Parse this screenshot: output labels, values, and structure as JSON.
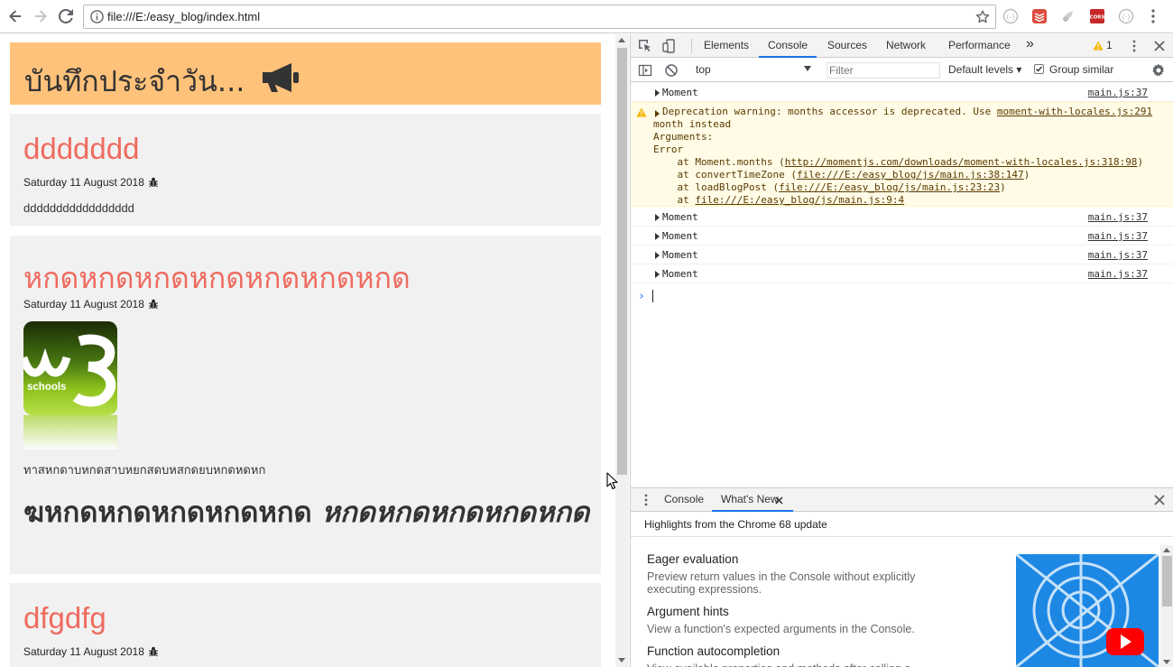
{
  "browser": {
    "url": "file:///E:/easy_blog/index.html"
  },
  "blog": {
    "header_title": "บันทึกประจำวัน...",
    "header_color": "#ffc27a",
    "title_color": "#ef6b5f",
    "posts": [
      {
        "title": "ddddddd",
        "date": "Saturday 11 August 2018",
        "body": "ddddddddddddddddd"
      },
      {
        "title": "หกดหกดหกดหกดหกดหกดหกด",
        "date": "Saturday 11 August 2018",
        "image_text": "schools",
        "body": "ทาสหกดาบหกดสาบหยกสดบหสกดยบหกดหดหก",
        "heading_bold": "ฆหกดหกดหกดหกดหกด",
        "heading_italic": "หกดหกดหกดหกดหกด"
      },
      {
        "title": "dfgdfg",
        "date": "Saturday 11 August 2018"
      }
    ]
  },
  "devtools": {
    "tabs": [
      "Elements",
      "Console",
      "Sources",
      "Network",
      "Performance"
    ],
    "active_tab": "Console",
    "more_tabs": "»",
    "warning_count": "1",
    "context": "top",
    "filter_placeholder": "Filter",
    "levels": "Default levels ▾",
    "group_similar": "Group similar",
    "messages": [
      {
        "text": "Moment",
        "source": "main.js:37"
      },
      {
        "level": "warning",
        "line1": "Deprecation warning: months accessor is deprecated. Use ",
        "line1_link": "moment-with-locales.js:291",
        "line2": "month instead",
        "line3": "Arguments:",
        "line4": "Error",
        "line5_pre": "    at Moment.months (",
        "line5_link": "http://momentjs.com/downloads/moment-with-locales.js:318:98",
        "line5_post": ")",
        "line6_pre": "    at convertTimeZone (",
        "line6_link": "file:///E:/easy_blog/js/main.js:38:147",
        "line6_post": ")",
        "line7_pre": "    at loadBlogPost (",
        "line7_link": "file:///E:/easy_blog/js/main.js:23:23",
        "line7_post": ")",
        "line8_pre": "    at ",
        "line8_link": "file:///E:/easy_blog/js/main.js:9:4"
      },
      {
        "text": "Moment",
        "source": "main.js:37"
      },
      {
        "text": "Moment",
        "source": "main.js:37"
      },
      {
        "text": "Moment",
        "source": "main.js:37"
      },
      {
        "text": "Moment",
        "source": "main.js:37"
      }
    ],
    "prompt": "›",
    "drawer": {
      "tabs": [
        "Console",
        "What's New"
      ],
      "active_tab": "What's New",
      "highlights": "Highlights from the Chrome 68 update",
      "features": [
        {
          "title": "Eager evaluation",
          "desc": "Preview return values in the Console without explicitly executing expressions."
        },
        {
          "title": "Argument hints",
          "desc": "View a function's expected arguments in the Console."
        },
        {
          "title": "Function autocompletion",
          "desc": "View available properties and methods after calling a function."
        }
      ]
    }
  }
}
